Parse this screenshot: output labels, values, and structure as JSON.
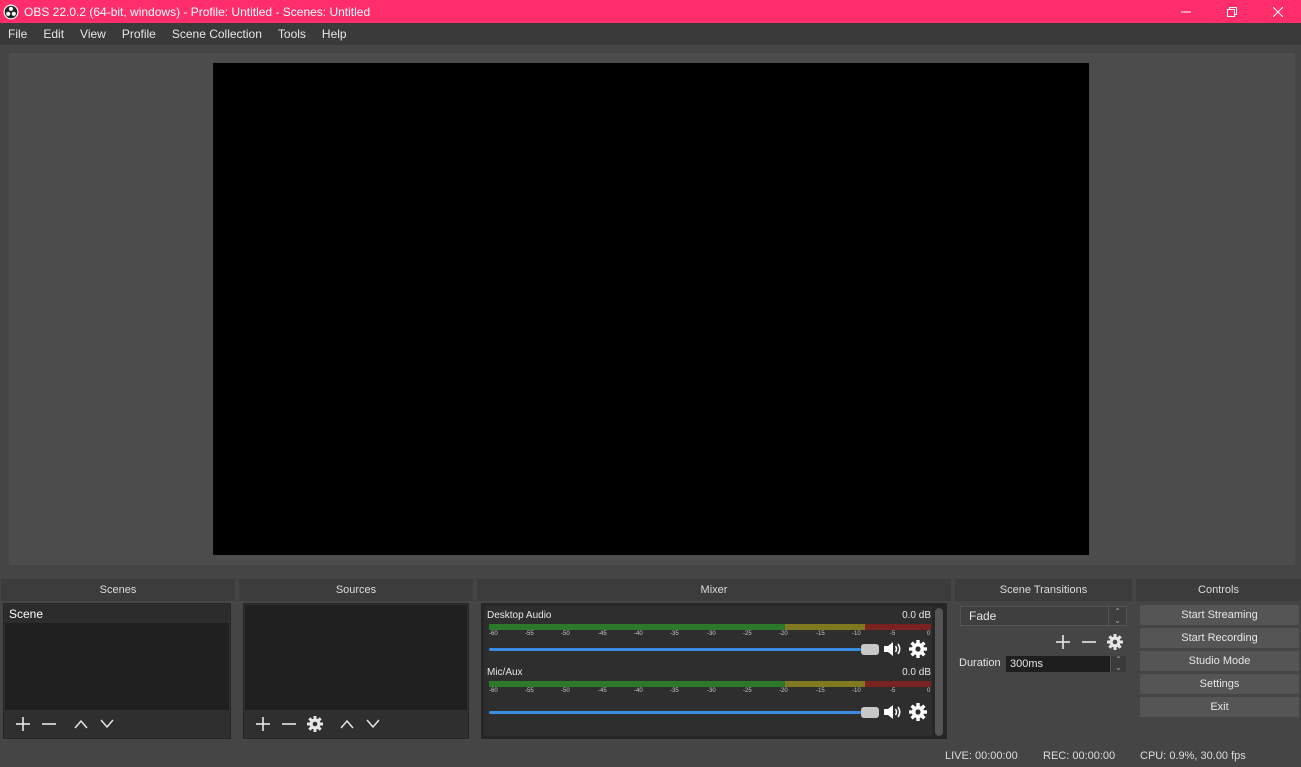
{
  "window": {
    "title": "OBS 22.0.2 (64-bit, windows) - Profile: Untitled - Scenes: Untitled",
    "accent": "#ff2d6a"
  },
  "menu": [
    "File",
    "Edit",
    "View",
    "Profile",
    "Scene Collection",
    "Tools",
    "Help"
  ],
  "docks": {
    "scenes": "Scenes",
    "sources": "Sources",
    "mixer": "Mixer",
    "transitions": "Scene Transitions",
    "controls": "Controls"
  },
  "scenes": {
    "items": [
      "Scene"
    ]
  },
  "mixer": {
    "scale": [
      "-60",
      "-55",
      "-50",
      "-45",
      "-40",
      "-35",
      "-30",
      "-25",
      "-20",
      "-15",
      "-10",
      "-5",
      "0"
    ],
    "channels": [
      {
        "name": "Desktop Audio",
        "db": "0.0 dB",
        "volume": 1.0
      },
      {
        "name": "Mic/Aux",
        "db": "0.0 dB",
        "volume": 1.0
      }
    ]
  },
  "transitions": {
    "selected": "Fade",
    "duration_label": "Duration",
    "duration_value": "300ms"
  },
  "controls": [
    "Start Streaming",
    "Start Recording",
    "Studio Mode",
    "Settings",
    "Exit"
  ],
  "status": {
    "live": "LIVE: 00:00:00",
    "rec": "REC: 00:00:00",
    "cpu": "CPU: 0.9%, 30.00 fps"
  }
}
